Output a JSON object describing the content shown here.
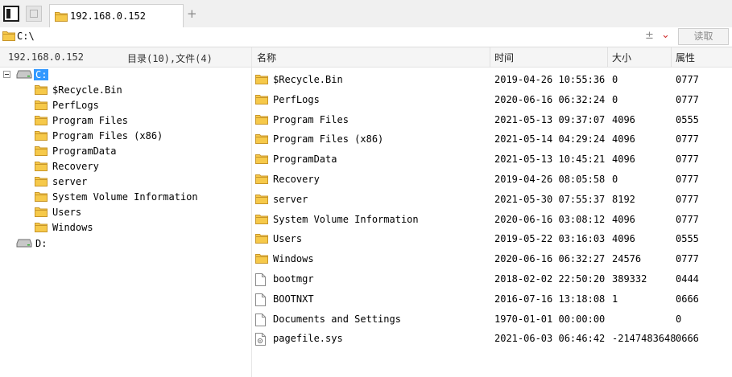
{
  "tab": {
    "label": "192.168.0.152"
  },
  "address": {
    "path": "C:\\",
    "read_label": "读取",
    "pm_glyph": "±"
  },
  "left_header": {
    "host": "192.168.0.152",
    "counts": "目录(10),文件(4)"
  },
  "tree": {
    "drives": [
      {
        "label": "C:",
        "selected": true
      },
      {
        "label": "D:",
        "selected": false
      }
    ],
    "folders": [
      "$Recycle.Bin",
      "PerfLogs",
      "Program Files",
      "Program Files (x86)",
      "ProgramData",
      "Recovery",
      "server",
      "System Volume Information",
      "Users",
      "Windows"
    ]
  },
  "columns": {
    "name": "名称",
    "time": "时间",
    "size": "大小",
    "attr": "属性"
  },
  "files": [
    {
      "type": "folder",
      "name": "$Recycle.Bin",
      "time": "2019-04-26 10:55:36",
      "size": "0",
      "attr": "0777"
    },
    {
      "type": "folder",
      "name": "PerfLogs",
      "time": "2020-06-16 06:32:24",
      "size": "0",
      "attr": "0777"
    },
    {
      "type": "folder",
      "name": "Program Files",
      "time": "2021-05-13 09:37:07",
      "size": "4096",
      "attr": "0555"
    },
    {
      "type": "folder",
      "name": "Program Files (x86)",
      "time": "2021-05-14 04:29:24",
      "size": "4096",
      "attr": "0777"
    },
    {
      "type": "folder",
      "name": "ProgramData",
      "time": "2021-05-13 10:45:21",
      "size": "4096",
      "attr": "0777"
    },
    {
      "type": "folder",
      "name": "Recovery",
      "time": "2019-04-26 08:05:58",
      "size": "0",
      "attr": "0777"
    },
    {
      "type": "folder",
      "name": "server",
      "time": "2021-05-30 07:55:37",
      "size": "8192",
      "attr": "0777"
    },
    {
      "type": "folder",
      "name": "System Volume Information",
      "time": "2020-06-16 03:08:12",
      "size": "4096",
      "attr": "0777"
    },
    {
      "type": "folder",
      "name": "Users",
      "time": "2019-05-22 03:16:03",
      "size": "4096",
      "attr": "0555"
    },
    {
      "type": "folder",
      "name": "Windows",
      "time": "2020-06-16 06:32:27",
      "size": "24576",
      "attr": "0777"
    },
    {
      "type": "file",
      "name": "bootmgr",
      "time": "2018-02-02 22:50:20",
      "size": "389332",
      "attr": "0444"
    },
    {
      "type": "file",
      "name": "BOOTNXT",
      "time": "2016-07-16 13:18:08",
      "size": "1",
      "attr": "0666"
    },
    {
      "type": "file",
      "name": "Documents and Settings",
      "time": "1970-01-01 00:00:00",
      "size": "",
      "attr": "0"
    },
    {
      "type": "sysfile",
      "name": "pagefile.sys",
      "time": "2021-06-03 06:46:42",
      "size": "-2147483648",
      "attr": "0666"
    }
  ]
}
